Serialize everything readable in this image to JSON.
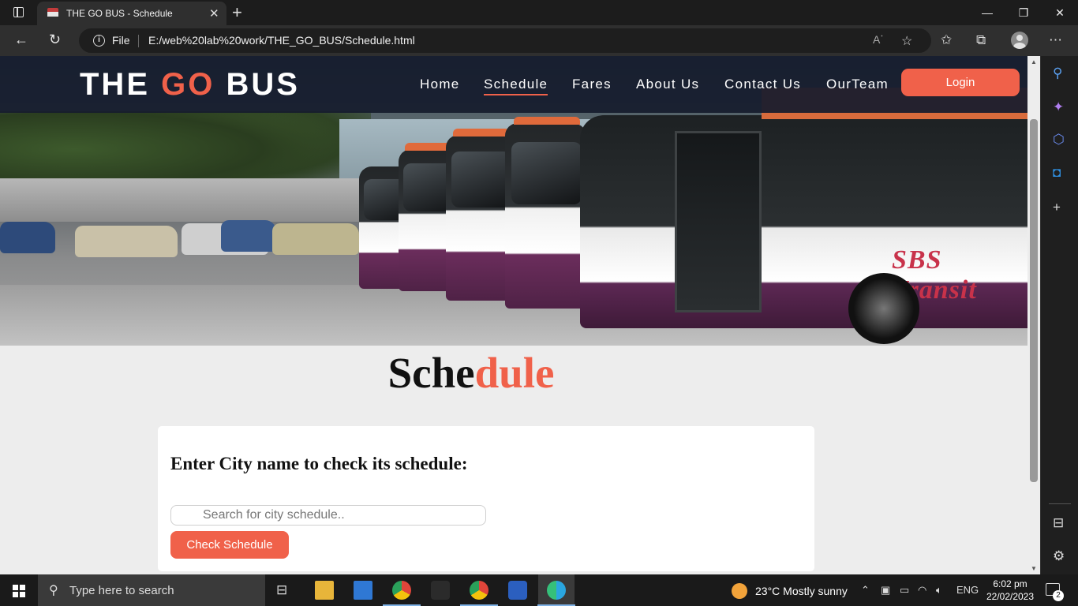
{
  "browser": {
    "tab_title": "THE GO BUS - Schedule",
    "file_label": "File",
    "url": "E:/web%20lab%20work/THE_GO_BUS/Schedule.html"
  },
  "site": {
    "logo_left": "THE ",
    "logo_go": "GO",
    "logo_right": " BUS",
    "nav": [
      "Home",
      "Schedule",
      "Fares",
      "About Us",
      "Contact Us",
      "OurTeam"
    ],
    "active_nav": "Schedule",
    "login_label": "Login",
    "hero_bus_text": "SBS Transit"
  },
  "main": {
    "title_dark": "Sche",
    "title_accent": "dule",
    "card_heading": "Enter City name to check its schedule:",
    "search_placeholder": "Search for city schedule..",
    "search_value": "",
    "check_button": "Check Schedule"
  },
  "taskbar": {
    "search_text": "Type here to search",
    "weather_temp": "23°C",
    "weather_text": "Mostly sunny",
    "lang": "ENG",
    "time": "6:02 pm",
    "date": "22/02/2023",
    "notification_count": "2"
  },
  "colors": {
    "accent": "#f0614a",
    "header_bg": "#161c2d",
    "page_bg": "#ededed"
  }
}
